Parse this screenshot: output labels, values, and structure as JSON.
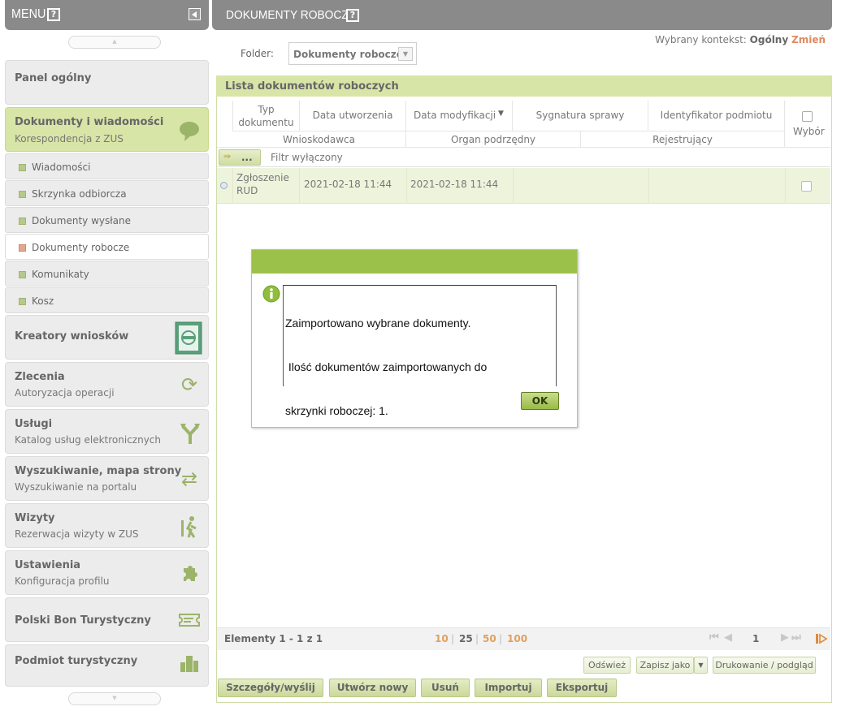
{
  "sidebar": {
    "title": "MENU",
    "help": "?",
    "items": [
      {
        "title": "Panel ogólny"
      },
      {
        "title": "Dokumenty i wiadomości",
        "subtitle": "Korespondencja z ZUS"
      },
      {
        "title": "Kreatory wniosków"
      },
      {
        "title": "Zlecenia",
        "subtitle": "Autoryzacja operacji"
      },
      {
        "title": "Usługi",
        "subtitle": "Katalog usług elektronicznych"
      },
      {
        "title": "Wyszukiwanie, mapa strony",
        "subtitle": "Wyszukiwanie na portalu"
      },
      {
        "title": "Wizyty",
        "subtitle": "Rezerwacja wizyty w ZUS"
      },
      {
        "title": "Ustawienia",
        "subtitle": "Konfiguracja profilu"
      },
      {
        "title": "Polski Bon Turystyczny"
      },
      {
        "title": "Podmiot turystyczny"
      }
    ],
    "subitems": [
      "Wiadomości",
      "Skrzynka odbiorcza",
      "Dokumenty wysłane",
      "Dokumenty robocze",
      "Komunikaty",
      "Kosz"
    ]
  },
  "header": {
    "title": "DOKUMENTY ROBOCZE",
    "help": "?"
  },
  "context": {
    "label": "Wybrany kontekst:",
    "value": "Ogólny",
    "change": "Zmień"
  },
  "folder": {
    "label": "Folder:",
    "value": "Dokumenty robocze"
  },
  "list": {
    "title": "Lista dokumentów roboczych",
    "columns": {
      "typ": "Typ dokumentu",
      "utworzenia": "Data utworzenia",
      "modyfikacji": "Data modyfikacji",
      "sygnatura": "Sygnatura sprawy",
      "identyfikator": "Identyfikator podmiotu",
      "wybor": "Wybór",
      "wnioskodawca": "Wnioskodawca",
      "organ": "Organ podrzędny",
      "rejestrujacy": "Rejestrujący"
    },
    "filter_btn": "...",
    "filter_text": "Filtr wyłączony",
    "rows": [
      {
        "typ_line1": "Zgłoszenie",
        "typ_line2": "RUD",
        "utworzenia": "2021-02-18 11:44",
        "modyfikacji": "2021-02-18 11:44"
      }
    ]
  },
  "dialog": {
    "line1": "Zaimportowano wybrane dokumenty.",
    "line2": " Ilość dokumentów zaimportowanych do",
    "line3": "skrzynki roboczej: 1.",
    "ok": "OK"
  },
  "pagination": {
    "summary": "Elementy 1 - 1 z 1",
    "sizes": [
      "10",
      "25",
      "50",
      "100"
    ],
    "separator": "|",
    "page": "1"
  },
  "actions": {
    "refresh": "Odśwież",
    "save_as": "Zapisz jako",
    "print": "Drukowanie / podgląd"
  },
  "buttons": {
    "details": "Szczegóły/wyślij",
    "create": "Utwórz nowy",
    "delete": "Usuń",
    "import": "Importuj",
    "export": "Eksportuj"
  },
  "colors": {
    "accent_green": "#9cc14b",
    "header_gray": "#8a8a8a",
    "row_highlight": "#eef4dc",
    "link_orange": "#e08a60"
  }
}
